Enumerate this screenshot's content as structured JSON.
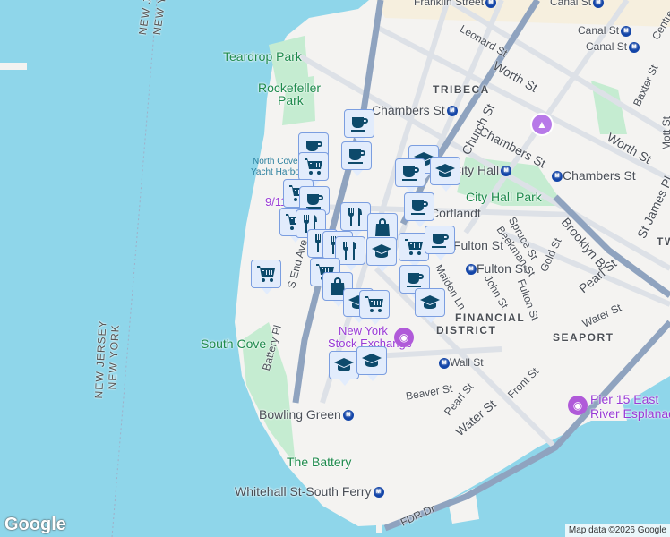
{
  "map": {
    "logo": "Google",
    "attribution": "Map data ©2026 Google",
    "labels": {
      "franklin": "Franklin Street",
      "canal1": "Canal St",
      "canal2": "Canal St",
      "canal3": "Canal St",
      "leonard": "Leonard St",
      "centre": "Centre",
      "worth1": "Worth St",
      "worth2": "Worth St",
      "baxter": "Baxter St",
      "mott": "Mott St",
      "tribeca": "TRIBECA",
      "chambers1": "Chambers St",
      "chambers2": "Chambers St",
      "chambers3": "Chambers St",
      "church": "Church St",
      "cityhall": "City Hall",
      "cityhallpark": "City Hall Park",
      "cortlandt": "Cortlandt",
      "fulton1": "Fulton St",
      "fulton2": "Fulton St",
      "fulton3": "Fulton St",
      "spruce": "Spruce St",
      "beekman": "Beekman St",
      "gold": "Gold St",
      "john": "John St",
      "maiden": "Maiden Ln",
      "brooklynbr": "Brooklyn Br",
      "stjames": "St James Pl",
      "pearl1": "Pearl St",
      "pearl2": "Pearl St",
      "water1": "Water St",
      "water2": "Water St",
      "seaport": "SEAPORT",
      "financial1": "FINANCIAL",
      "financial2": "DISTRICT",
      "nyse1": "New York",
      "nyse2": "Stock Exchange",
      "wall": "Wall St",
      "beaver": "Beaver St",
      "front": "Front St",
      "pier15a": "Pier 15 East",
      "pier15b": "River Esplanade",
      "southcove": "South Cove",
      "batterypl": "Battery Pl",
      "sendave": "S End Ave",
      "bowling": "Bowling Green",
      "battery": "The Battery",
      "whitehall": "Whitehall St-South Ferry",
      "fdr": "FDR Dr",
      "teardrop": "Teardrop Park",
      "rockefeller1": "Rockefeller",
      "rockefeller2": "Park",
      "northcove1": "North Cove",
      "northcove2": "Yacht Harbor",
      "nine11": "9/11",
      "newjersey": "NEW JERSEY",
      "newyork": "NEW YORK",
      "tw": "TW"
    },
    "markers": [
      "cup",
      "cup",
      "cart",
      "cup",
      "graduation-cap",
      "cup",
      "graduation-cap",
      "cart",
      "cup",
      "cart",
      "fork-knife",
      "fork-knife",
      "cup",
      "shopping-bag",
      "fork-knife",
      "fork-knife",
      "fork-knife",
      "graduation-cap",
      "cart",
      "cup",
      "cart",
      "cart",
      "shopping-bag",
      "cup",
      "graduation-cap",
      "graduation-cap",
      "cart",
      "graduation-cap",
      "graduation-cap"
    ],
    "colors": {
      "water": "#8fd6ea",
      "land": "#f4f3f1",
      "park": "#c5ecd1",
      "marker_bg": "#e2ecfc",
      "marker_border": "#7b9ee0",
      "icon": "#0d4a6b"
    }
  }
}
